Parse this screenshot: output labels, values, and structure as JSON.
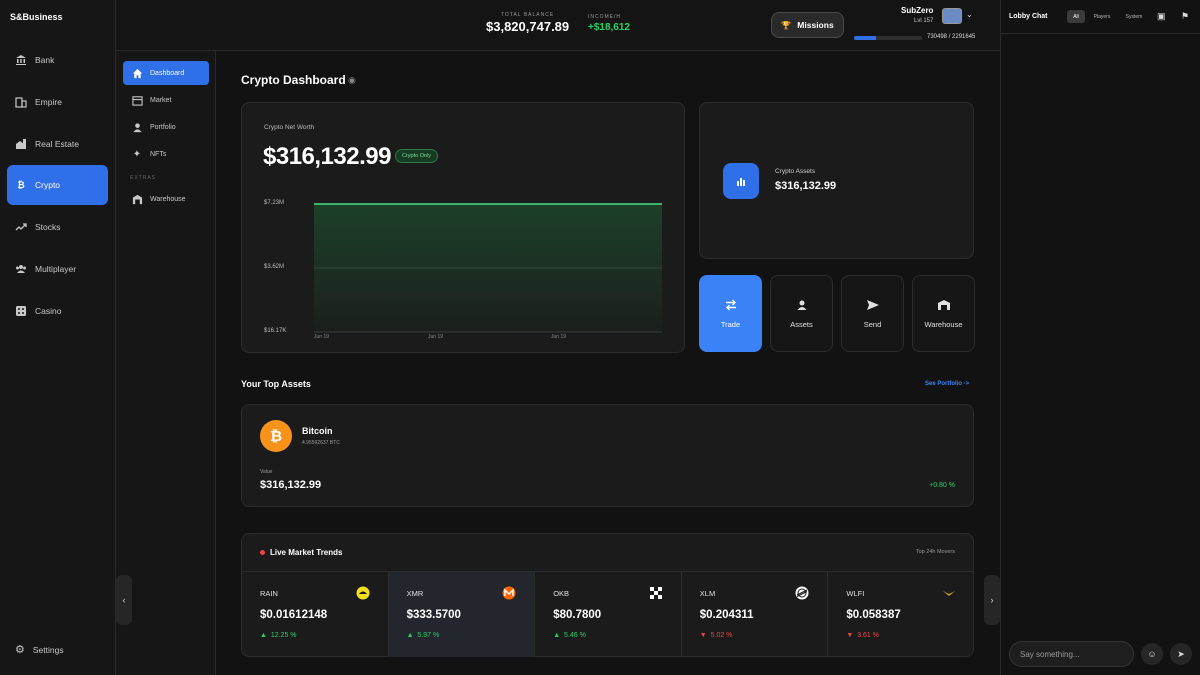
{
  "brand": "S&Business",
  "sidebar": {
    "items": [
      {
        "label": "Bank",
        "icon": "bank-icon"
      },
      {
        "label": "Empire",
        "icon": "building-icon"
      },
      {
        "label": "Real Estate",
        "icon": "real-estate-icon"
      },
      {
        "label": "Crypto",
        "icon": "bitcoin-icon",
        "active": true
      },
      {
        "label": "Stocks",
        "icon": "trend-up-icon"
      },
      {
        "label": "Multiplayer",
        "icon": "users-icon"
      },
      {
        "label": "Casino",
        "icon": "dice-icon"
      }
    ],
    "settings": "Settings"
  },
  "subsidebar": {
    "items": [
      {
        "label": "Dashboard",
        "icon": "home-icon",
        "active": true
      },
      {
        "label": "Market",
        "icon": "store-icon"
      },
      {
        "label": "Portfolio",
        "icon": "person-icon"
      },
      {
        "label": "NFTs",
        "icon": "sparkle-icon"
      }
    ],
    "extras_label": "EXTRAS",
    "extras": [
      {
        "label": "Warehouse",
        "icon": "warehouse-icon"
      }
    ]
  },
  "topbar": {
    "balance_label": "TOTAL BALANCE",
    "balance": "$3,820,747.89",
    "income_label": "INCOME/H",
    "income": "+$18,612",
    "missions": "Missions",
    "user_name": "SubZero",
    "user_level": "Lvl 157",
    "xp_text": "730498 / 2291645",
    "xp_fraction": 0.319
  },
  "main": {
    "title": "Crypto Dashboard",
    "networth_label": "Crypto Net Worth",
    "networth": "$316,132.99",
    "badge": "Crypto Only",
    "assets_label": "Crypto Assets",
    "assets_value": "$316,132.99",
    "actions": [
      {
        "label": "Trade",
        "icon": "swap-icon"
      },
      {
        "label": "Assets",
        "icon": "person-icon"
      },
      {
        "label": "Send",
        "icon": "send-icon"
      },
      {
        "label": "Warehouse",
        "icon": "warehouse-icon"
      }
    ],
    "top_assets_title": "Your Top Assets",
    "see_portfolio": "See Portfolio ->",
    "top_asset": {
      "name": "Bitcoin",
      "amount": "4.95592637 BTC",
      "value_label": "Value",
      "value": "$316,132.99",
      "change": "+0.80 %"
    },
    "trends_title": "Live Market Trends",
    "trends_right": "Top 24h Movers",
    "coins": [
      {
        "symbol": "RAIN",
        "price": "$0.01612148",
        "change": "12.25 %",
        "arrow": "▲",
        "dir": "up",
        "icon": "rain-coin-icon",
        "color": "#f2e11a"
      },
      {
        "symbol": "XMR",
        "price": "$333.5700",
        "change": "5.97 %",
        "arrow": "▲",
        "dir": "up",
        "icon": "monero-icon",
        "color": "#ff6600"
      },
      {
        "symbol": "OKB",
        "price": "$80.7800",
        "change": "5.46 %",
        "arrow": "▲",
        "dir": "up",
        "icon": "okb-icon",
        "color": "#ffffff"
      },
      {
        "symbol": "XLM",
        "price": "$0.204311",
        "change": "5.02 %",
        "arrow": "▼",
        "dir": "down",
        "icon": "stellar-icon",
        "color": "#ffffff"
      },
      {
        "symbol": "WLFI",
        "price": "$0.058387",
        "change": "3.61 %",
        "arrow": "▼",
        "dir": "down",
        "icon": "wlfi-icon",
        "color": "#d4a017"
      }
    ]
  },
  "chart_data": {
    "type": "area",
    "x": [
      "Jun 19",
      "Jun 19",
      "Jun 19"
    ],
    "series": [
      {
        "values": [
          7.23,
          7.23,
          7.23
        ]
      }
    ],
    "y_ticks": [
      "$7.23M",
      "$3.62M",
      "$16.17K"
    ],
    "ylim": [
      0.01617,
      7.23
    ],
    "grid": true,
    "color": "#4ade80"
  },
  "chat": {
    "title": "Lobby Chat",
    "tabs": [
      "All",
      "Players",
      "System"
    ],
    "placeholder": "Say something..."
  },
  "colors": {
    "accent": "#2f6fe8",
    "positive": "#26d46b",
    "negative": "#ef4444"
  }
}
